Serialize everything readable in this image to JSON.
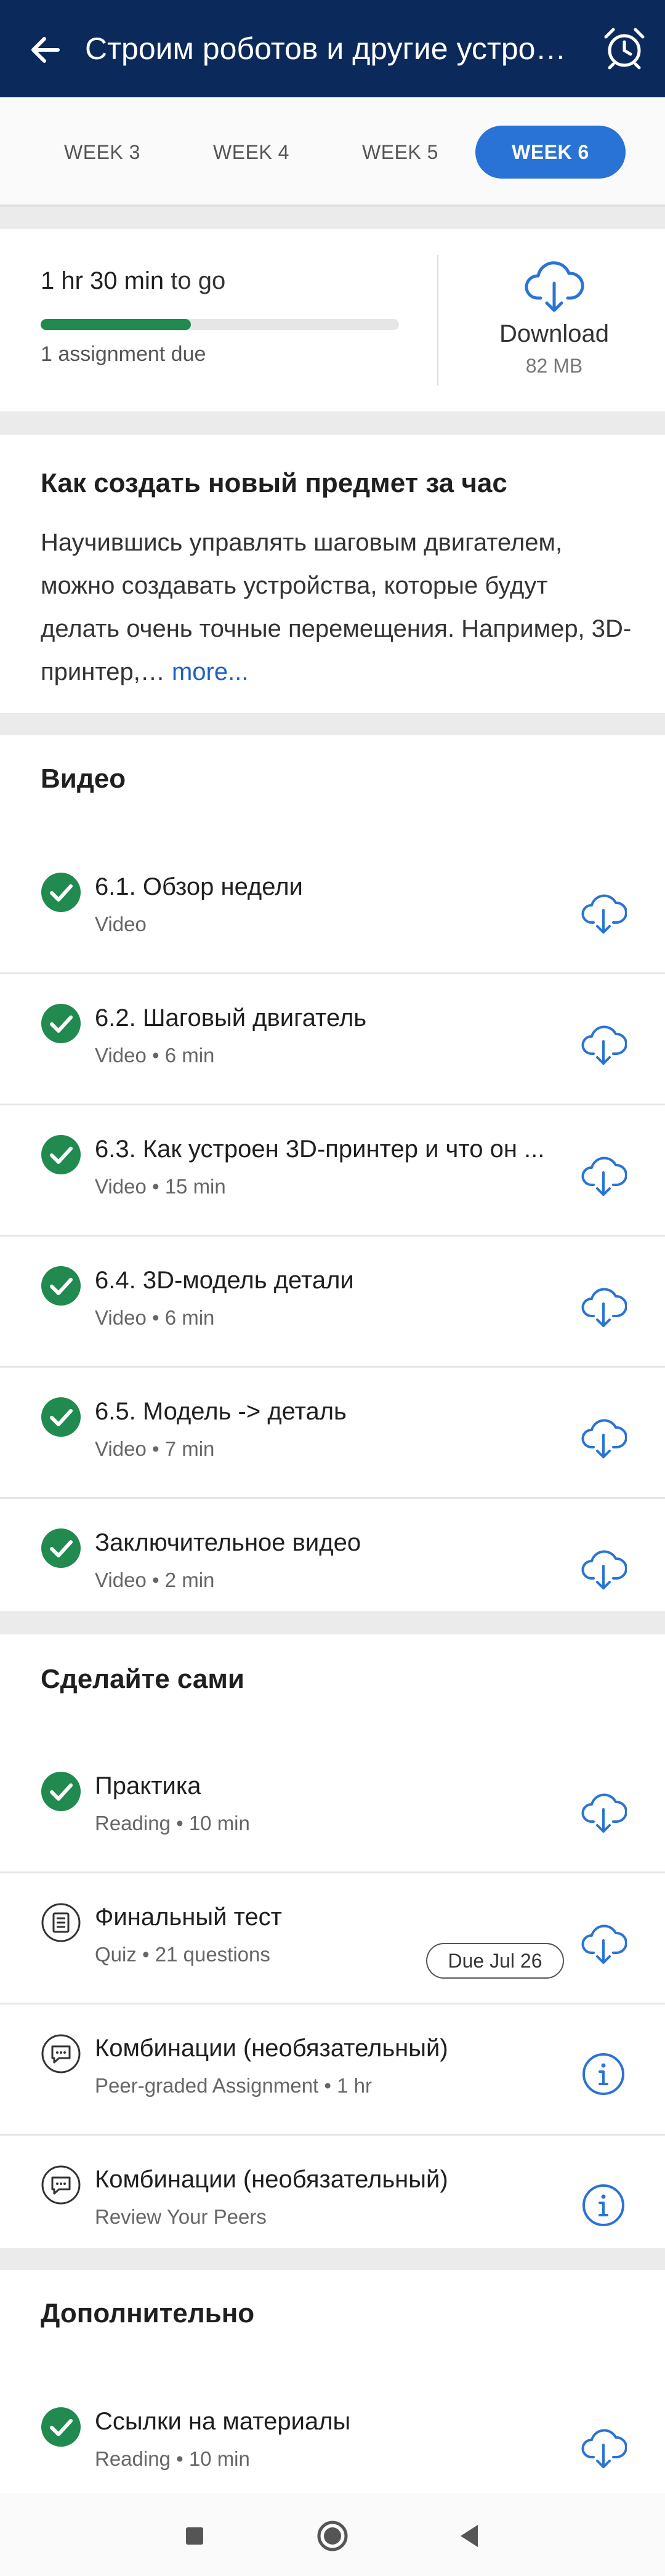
{
  "header": {
    "title": "Строим роботов и другие устрой...",
    "back_icon": "arrow-left-icon",
    "alarm_icon": "alarm-clock-icon"
  },
  "weeks": [
    {
      "label": "WEEK 3",
      "active": false
    },
    {
      "label": "WEEK 4",
      "active": false
    },
    {
      "label": "WEEK 5",
      "active": false
    },
    {
      "label": "WEEK 6",
      "active": true
    }
  ],
  "progress": {
    "time_value": "1 hr 30 min",
    "time_suffix": "to go",
    "fraction_complete": 0.42,
    "due_text": "1 assignment due",
    "download_label": "Download",
    "download_size": "82 MB"
  },
  "description": {
    "title": "Как создать новый предмет за час",
    "text": "Научившись управлять шаговым двигателем, можно создавать устройства, которые будут делать очень точные перемещения. Например, 3D-принтер,…",
    "more_label": "more..."
  },
  "video_section": {
    "title": "Видео",
    "items": [
      {
        "name": "6.1. Обзор недели",
        "meta": "Video"
      },
      {
        "name": "6.2. Шаговый двигатель",
        "meta": "Video • 6 min"
      },
      {
        "name": "6.3. Как устроен 3D-принтер и что он ...",
        "meta": "Video • 15 min"
      },
      {
        "name": "6.4. 3D-модель детали",
        "meta": "Video • 6 min"
      },
      {
        "name": "6.5. Модель -> деталь",
        "meta": "Video • 7 min"
      },
      {
        "name": "Заключительное видео",
        "meta": "Video • 2 min"
      }
    ]
  },
  "practice_section": {
    "title": "Сделайте сами",
    "items": [
      {
        "name": "Практика",
        "meta": "Reading • 10 min",
        "status": "completed",
        "action": "download"
      },
      {
        "name": "Финальный тест",
        "meta": "Quiz • 21 questions",
        "status": "quiz",
        "action": "download",
        "due": "Due Jul 26"
      },
      {
        "name": "Комбинации (необязательный)",
        "meta": "Peer-graded Assignment • 1 hr",
        "status": "peer",
        "action": "info"
      },
      {
        "name": "Комбинации (необязательный)",
        "meta": "Review Your Peers",
        "status": "peer",
        "action": "info"
      }
    ]
  },
  "extra_section": {
    "title": "Дополнительно",
    "items": [
      {
        "name": "Ссылки на материалы",
        "meta": "Reading • 10 min"
      }
    ]
  },
  "colors": {
    "header_bg": "#0b2a5b",
    "accent": "#2a73d6",
    "complete_green": "#218a4e",
    "link": "#1f5fc7"
  },
  "system_nav": {
    "recents_icon": "square-recents-icon",
    "home_icon": "circle-home-icon",
    "back_icon": "triangle-back-icon"
  }
}
